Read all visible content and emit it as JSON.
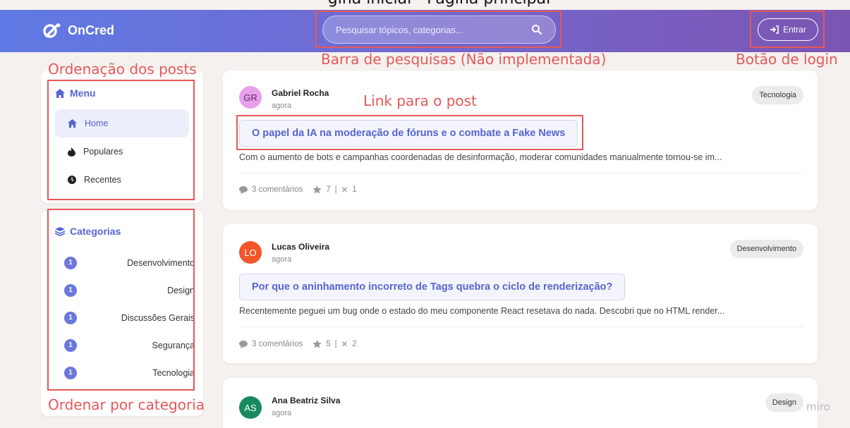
{
  "top_cut_text": "gina inicial - Página principal",
  "header": {
    "logo_text": "OnCred",
    "search_placeholder": "Pesquisar tópicos, categorias...",
    "login_label": "Entrar"
  },
  "annotations": {
    "sort_posts": "Ordenação dos posts",
    "search_bar": "Barra de pesquisas (Não implementada)",
    "login_button": "Botão de login",
    "post_link": "Link para o post",
    "sort_category": "Ordenar por categoria",
    "color": "#e5585a"
  },
  "sidebar": {
    "menu_title": "Menu",
    "menu_items": [
      {
        "label": "Home",
        "icon": "home-icon",
        "active": true
      },
      {
        "label": "Populares",
        "icon": "fire-icon",
        "active": false
      },
      {
        "label": "Recentes",
        "icon": "clock-icon",
        "active": false
      }
    ],
    "categories_title": "Categorias",
    "categories": [
      {
        "count": "1",
        "label": "Desenvolvimento"
      },
      {
        "count": "1",
        "label": "Design"
      },
      {
        "count": "1",
        "label": "Discussões Gerais"
      },
      {
        "count": "1",
        "label": "Segurança"
      },
      {
        "count": "1",
        "label": "Tecnologia"
      }
    ]
  },
  "posts": [
    {
      "initials": "GR",
      "avatar_color": "#e9a0ec",
      "avatar_text_color": "#5b2a6a",
      "author": "Gabriel Rocha",
      "time": "agora",
      "tag": "Tecnologia",
      "title": "O papel da IA na moderação de fóruns e o combate a Fake News",
      "excerpt": "Com o aumento de bots e campanhas coordenadas de desinformação, moderar comunidades manualmente tornou-se im...",
      "comments": "3 comentários",
      "stars": "7",
      "x": "1"
    },
    {
      "initials": "LO",
      "avatar_color": "#f2562a",
      "avatar_text_color": "#ffffff",
      "author": "Lucas Oliveira",
      "time": "agora",
      "tag": "Desenvolvimento",
      "title": "Por que o aninhamento incorreto de Tags quebra o ciclo de renderização?",
      "excerpt": "Recentemente peguei um bug onde o estado do meu componente React resetava do nada. Descobri que no HTML render...",
      "comments": "3 comentários",
      "stars": "5",
      "x": "2"
    },
    {
      "initials": "AS",
      "avatar_color": "#178a5e",
      "avatar_text_color": "#ffffff",
      "author": "Ana Beatriz Silva",
      "time": "agora",
      "tag": "Design"
    }
  ],
  "watermark": "miro",
  "colors": {
    "accent": "#5664d2",
    "header_start": "#5f7ae4",
    "header_end": "#7c55b2"
  }
}
